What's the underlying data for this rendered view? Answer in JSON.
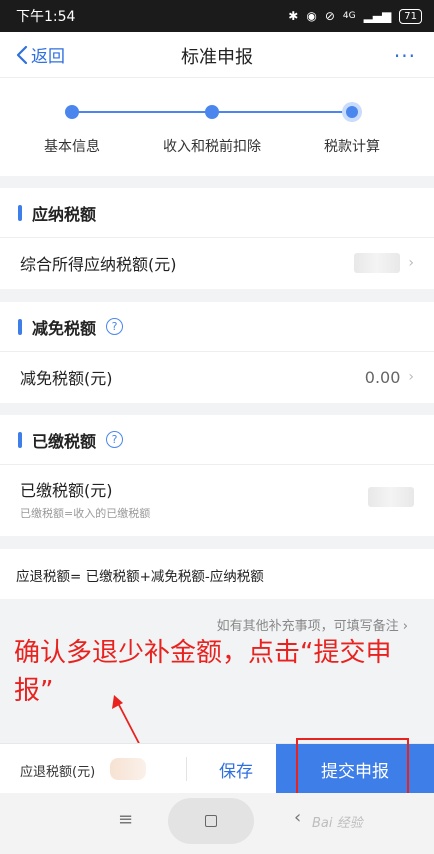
{
  "status_bar": {
    "time": "下午1:54",
    "network": "4G",
    "battery": "71"
  },
  "nav": {
    "back_label": "返回",
    "title": "标准申报",
    "more": "···"
  },
  "stepper": {
    "steps": [
      "基本信息",
      "收入和税前扣除",
      "税款计算"
    ]
  },
  "sections": {
    "payable": {
      "title": "应纳税额",
      "row_label": "综合所得应纳税额(元)"
    },
    "reduction": {
      "title": "减免税额",
      "row_label": "减免税额(元)",
      "row_value": "0.00"
    },
    "paid": {
      "title": "已缴税额",
      "row_label": "已缴税额(元)",
      "row_note": "已缴税额=收入的已缴税额"
    }
  },
  "formula": "应退税额= 已缴税额+减免税额-应纳税额",
  "remark_link": "如有其他补充事项，可填写备注",
  "annotation": "确认多退少补金额，点击“提交申报”",
  "bottom": {
    "refund_label": "应退税额(元)",
    "save": "保存",
    "submit": "提交申报"
  },
  "sysnav": {
    "menu": "≡",
    "back": "‹"
  },
  "watermark": "Bai 经验",
  "colors": {
    "accent": "#3d7ee8",
    "annotation": "#e8231f"
  }
}
